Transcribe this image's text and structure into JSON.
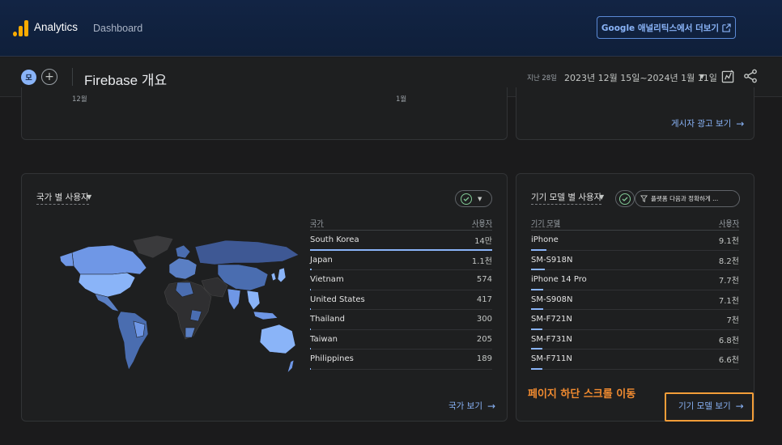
{
  "header": {
    "app_name": "Analytics",
    "sub_name": "Dashboard",
    "ga_button": "Google 애널리틱스에서 더보기",
    "ga_button_icon": "open-in-new-icon",
    "brand_color": "#f9ab00"
  },
  "subheader": {
    "chip_label": "모",
    "page_title": "Firebase 개요",
    "date_label": "지난 28일",
    "date_range": "2023년 12월 15일~2024년 1월 11일"
  },
  "top_left_card": {
    "x_tick_1": "12월",
    "x_tick_2": "1월"
  },
  "top_right_card": {
    "link": "게시자 광고 보기"
  },
  "country_card": {
    "title": "국가 별 사용자",
    "col_country": "국가",
    "col_users": "사용자",
    "rows": [
      {
        "name": "South Korea",
        "value": "14만",
        "share": 1.0
      },
      {
        "name": "Japan",
        "value": "1.1천",
        "share": 0.008
      },
      {
        "name": "Vietnam",
        "value": "574",
        "share": 0.004
      },
      {
        "name": "United States",
        "value": "417",
        "share": 0.003
      },
      {
        "name": "Thailand",
        "value": "300",
        "share": 0.002
      },
      {
        "name": "Taiwan",
        "value": "205",
        "share": 0.0015
      },
      {
        "name": "Philippines",
        "value": "189",
        "share": 0.0013
      }
    ],
    "link": "국가 보기"
  },
  "device_card": {
    "title": "기기 모델 별 사용자",
    "filter": "플랫폼 다음과 정확하게 ...",
    "col_model": "기기 모델",
    "col_users": "사용자",
    "rows": [
      {
        "name": "iPhone",
        "value": "9.1천",
        "share": 0.12
      },
      {
        "name": "SM-S918N",
        "value": "8.2천",
        "share": 0.11
      },
      {
        "name": "iPhone 14 Pro",
        "value": "7.7천",
        "share": 0.1
      },
      {
        "name": "SM-S908N",
        "value": "7.1천",
        "share": 0.095
      },
      {
        "name": "SM-F721N",
        "value": "7천",
        "share": 0.094
      },
      {
        "name": "SM-F731N",
        "value": "6.8천",
        "share": 0.09
      },
      {
        "name": "SM-F711N",
        "value": "6.6천",
        "share": 0.088
      }
    ],
    "link": "기기 모델 보기"
  },
  "notice": "페이지 하단 스크롤 이동",
  "accent_color": "#8ab4f8",
  "highlight_color": "#f29d38"
}
